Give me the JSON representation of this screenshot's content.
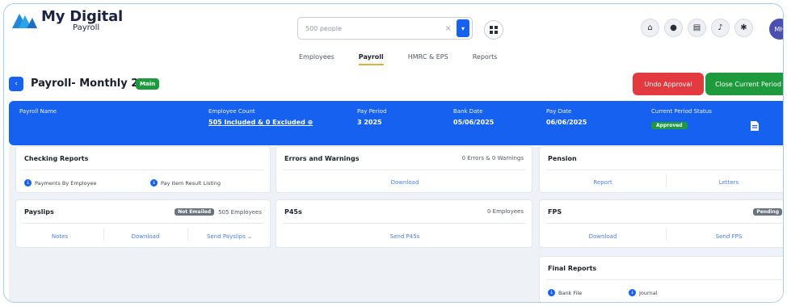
{
  "app": {
    "title": "My Digital",
    "subtitle": "Payroll"
  },
  "search": {
    "value": "500 people",
    "clear": "×"
  },
  "nav": {
    "tabs": [
      "Employees",
      "Payroll",
      "HMRC & EPS",
      "Reports"
    ],
    "active": "Payroll"
  },
  "user": {
    "initials": "MH"
  },
  "page": {
    "title": "Payroll- Monthly 2",
    "badge": "Main"
  },
  "actions": {
    "undo_approval": "Undo Approval",
    "close_period": "Close Current Period"
  },
  "banner": {
    "payroll_name_label": "Payroll Name",
    "employee_count_label": "Employee Count",
    "employee_count_value": "505 Included & 0 Excluded",
    "pay_period_label": "Pay Period",
    "pay_period_value": "3 2025",
    "bank_date_label": "Bank Date",
    "bank_date_value": "05/06/2025",
    "pay_date_label": "Pay Date",
    "pay_date_value": "06/06/2025",
    "status_label": "Current Period Status",
    "status_value": "Approved"
  },
  "cards": {
    "checking_reports": {
      "title": "Checking Reports",
      "item1": "Payments By Employee",
      "item2": "Pay Item Result Listing"
    },
    "errors": {
      "title": "Errors and Warnings",
      "summary": "0 Errors & 0 Warnings",
      "action": "Download"
    },
    "pension": {
      "title": "Pension",
      "action1": "Report",
      "action2": "Letters"
    },
    "payslips": {
      "title": "Payslips",
      "badge": "Not Emailed",
      "count": "505 Employees",
      "action1": "Notes",
      "action2": "Download",
      "action3": "Send Payslips"
    },
    "p60s": {
      "title": "P45s",
      "count": "0 Employees",
      "action": "Send P45s"
    },
    "fps": {
      "title": "FPS",
      "badge": "Pending",
      "action1": "Download",
      "action2": "Send FPS"
    },
    "final_reports": {
      "title": "Final Reports",
      "item1": "Bank File",
      "item2": "Journal"
    }
  },
  "colors": {
    "primary": "#1761f0",
    "danger": "#e23a3f",
    "success": "#1e9a3d",
    "accent_underline": "#e0b23c"
  }
}
